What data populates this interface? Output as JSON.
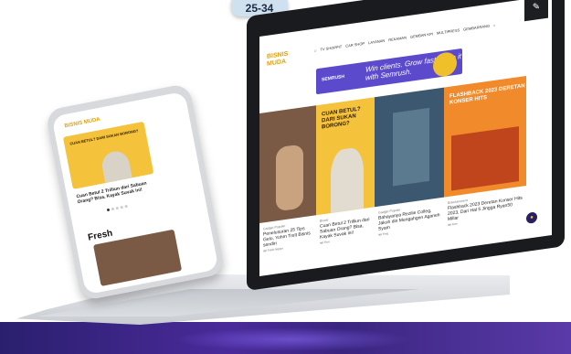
{
  "badge": {
    "label": "25-34"
  },
  "laptop": {
    "logo": "BISNIS MUDA",
    "nav": [
      "TV SHOPPIT",
      "CAR SHOP",
      "LAYANAN",
      "REKAMAN",
      "GEMBAN KPI",
      "MULTIPRESS",
      "GEMBARRANG"
    ],
    "banner": {
      "brand": "SEMRUSH",
      "headline": "Win clients. Grow faster. Do it with Semrush."
    },
    "cards": [
      {
        "headline": ""
      },
      {
        "headline": "CUAN BETUL? DARI SUKAN BORONG?"
      },
      {
        "headline": ""
      },
      {
        "headline": "FLASHBACK 2023 DERETAN KONSER HITS"
      }
    ],
    "articles": [
      {
        "category": "Gadget Populer",
        "title": "Penelusuran 25 Tips Gelo, Yohm Trelt Bisnis sendiri",
        "author": "Itel Tresh Nguyn"
      },
      {
        "category": "Bisnis",
        "title": "Cuan Betul 2 Trilliun dari Sabuan Orang? Bisa, Kayak Suvak ini!",
        "author": "Itel Finn"
      },
      {
        "category": "Gadget Populer",
        "title": "Bahayanya Rezilie Colleg, Jakoh din Mengahgnn Aganeh Syam",
        "author": "Itel Frog"
      },
      {
        "category": "Entertainment",
        "title": "Flashback 2023 Deretan Konser Hits 2023, Dari Hal 5 Jingga Ryan50 Millar",
        "author": "Itel Finn"
      }
    ],
    "icons": {
      "edit": "pencil-icon",
      "home": "home-icon",
      "search": "search-icon"
    }
  },
  "phone": {
    "logo": "BISNIS MUDA",
    "hero_headline": "CUAN BETUL? DARI SUKAN BORONG?",
    "article_title": "Cuan Betul 2 Trilliun dari Sabuan Orang? Bisa, Kayak Suvak ini!",
    "section": "Fresh"
  }
}
